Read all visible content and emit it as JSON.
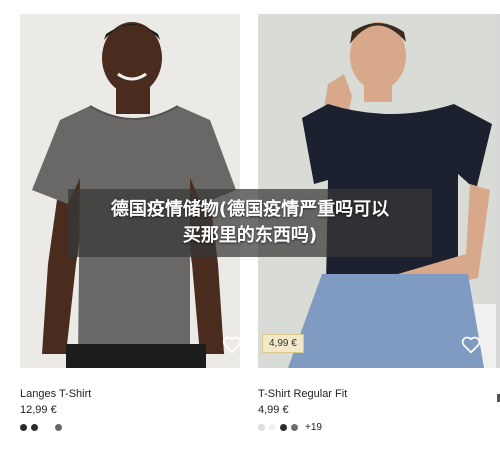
{
  "overlay": {
    "line1": "德国疫情储物(德国疫情严重吗可以",
    "line2": "买那里的东西吗)"
  },
  "products": [
    {
      "name": "Langes T-Shirt",
      "price": "12,99 €",
      "favorite_icon": "heart-outline-icon",
      "swatches": [
        "#2b2b2b",
        "#2b2b2b",
        "gap",
        "#666666"
      ]
    },
    {
      "name": "T-Shirt Regular Fit",
      "price": "4,99 €",
      "price_tag": "4,99 €",
      "favorite_icon": "heart-outline-icon",
      "swatches": [
        "#dcdcdc",
        "#f2f2f2",
        "#2b2b2b",
        "#6e6e6e"
      ],
      "more_colors": "+19"
    }
  ],
  "colors": {
    "shirt_grey": "#6a6866",
    "shirt_navy": "#1c2130",
    "jeans": "#7f9bc2",
    "skin_dark": "#4a2c1e",
    "skin_light": "#d8a88a",
    "price_tag_bg": "#f3e9c9"
  }
}
